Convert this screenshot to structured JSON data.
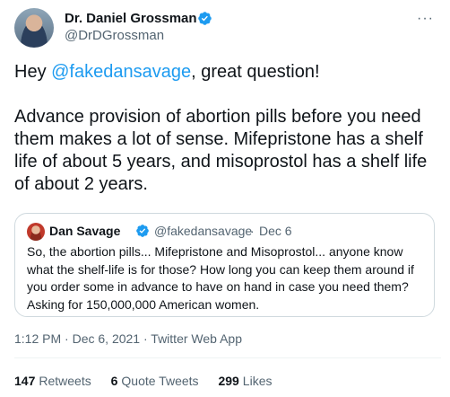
{
  "author": {
    "name": "Dr. Daniel Grossman",
    "handle": "@DrDGrossman"
  },
  "more_label": "···",
  "tweet": {
    "greeting_prefix": "Hey ",
    "mention": "@fakedansavage",
    "greeting_suffix": ", great question!",
    "paragraph2": "Advance provision of abortion pills before you need them makes a lot of sense. Mifepristone has a shelf life of about 5 years, and misoprostol has a shelf life of about 2 years."
  },
  "quoted": {
    "name": "Dan Savage",
    "handle": "@fakedansavage",
    "separator": "·",
    "date": "Dec 6",
    "text": "So, the abortion pills... Mifepristone and Misoprostol... anyone know what the shelf-life is for those? How long you can keep them around if you order some in advance to have on hand in case you need them? Asking for 150,000,000 American women."
  },
  "meta": {
    "time": "1:12 PM",
    "separator1": " · ",
    "date": "Dec 6, 2021",
    "separator2": " · ",
    "source": "Twitter Web App"
  },
  "stats": {
    "retweets_count": "147",
    "retweets_label": "Retweets",
    "quotes_count": "6",
    "quotes_label": "Quote Tweets",
    "likes_count": "299",
    "likes_label": "Likes"
  },
  "colors": {
    "accent": "#1d9bf0",
    "text": "#0f1419",
    "secondary": "#536471",
    "border": "#cfd9de"
  },
  "icons": {
    "verified": "verified-badge-icon",
    "more": "more-horizontal-icon"
  }
}
